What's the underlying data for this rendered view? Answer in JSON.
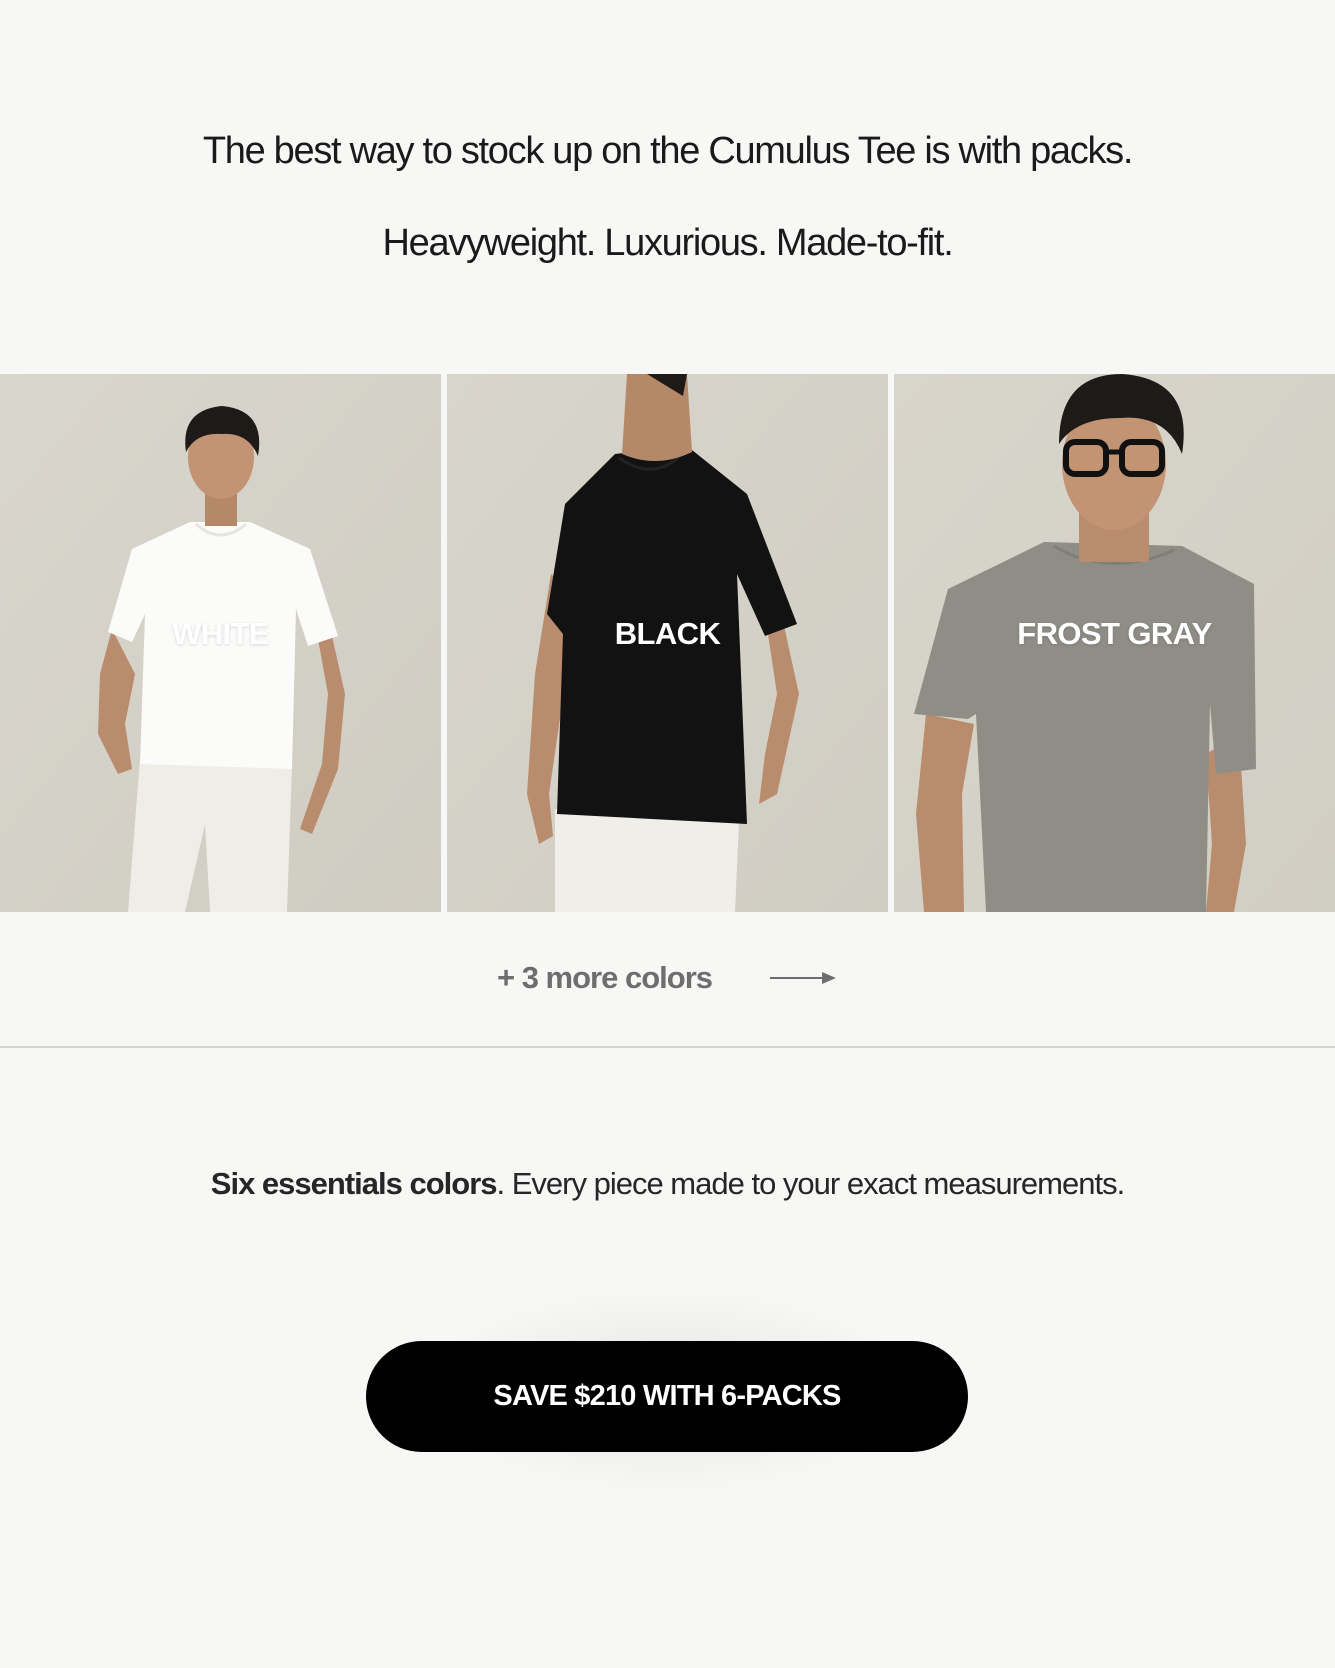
{
  "header": {
    "headline": "The best way to stock up on the Cumulus Tee is with packs.",
    "subheadline": "Heavyweight. Luxurious. Made-to-fit."
  },
  "colors": [
    {
      "label": "WHITE",
      "tee": "#fbfbf9",
      "pants": "#efeee8"
    },
    {
      "label": "BLACK",
      "tee": "#111111",
      "pants": "#efeee8"
    },
    {
      "label": "FROST GRAY",
      "tee": "#8f8e86",
      "pants": "#d7d5cc"
    }
  ],
  "more_colors": {
    "label": "+ 3 more colors",
    "icon": "arrow-right-icon"
  },
  "tagline": {
    "bold": "Six essentials colors",
    "rest": ". Every piece made to your exact measurements."
  },
  "cta": {
    "label": "SAVE $210 WITH 6-PACKS"
  },
  "theme": {
    "background": "#f7f7f5",
    "photo_backdrop": "#d6d3ca",
    "cta_background": "#000000",
    "muted_text": "#6e6e6e"
  }
}
